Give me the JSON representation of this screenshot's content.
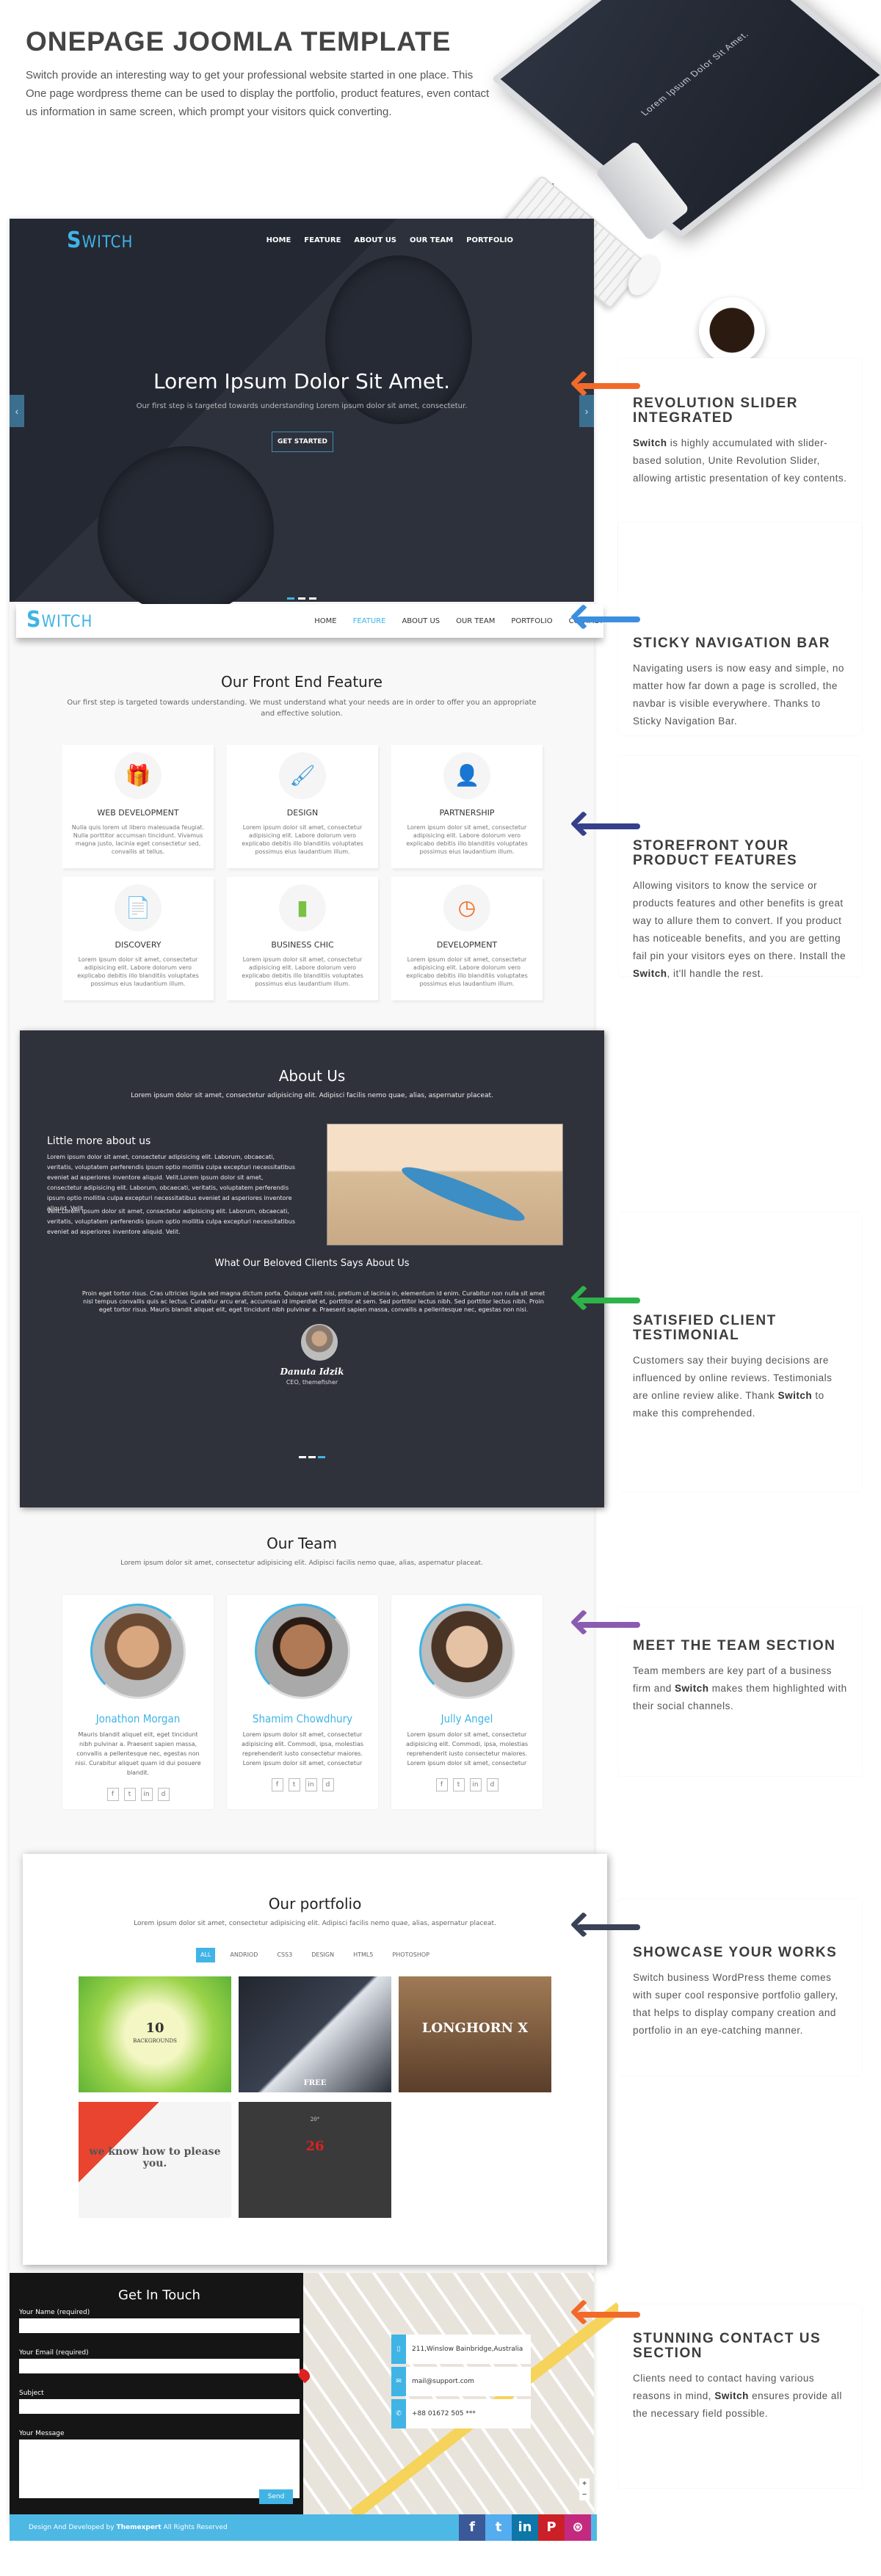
{
  "header": {
    "title": "ONEPAGE JOOMLA TEMPLATE",
    "intro": "Switch provide an interesting way to get your professional website started in one place. This One page wordpress theme can be used to display the portfolio, product features, even contact us information in same screen, which prompt your visitors quick converting."
  },
  "mockup": {
    "screen_text": "Lorem Ipsum Dolor Sit Amet."
  },
  "brand": {
    "logo_s": "S",
    "logo_rest": "WITCH",
    "accent": "#40b4e5"
  },
  "hero": {
    "nav": [
      "HOME",
      "FEATURE",
      "ABOUT US",
      "OUR TEAM",
      "PORTFOLIO"
    ],
    "title": "Lorem Ipsum Dolor Sit Amet.",
    "subtitle": "Our first step is targeted towards understanding Lorem ipsum dolor sit amet, consectetur.",
    "button": "GET STARTED",
    "prev_icon": "chevron-left",
    "next_icon": "chevron-right",
    "active_slide": 1,
    "slides": 3
  },
  "sticky_nav": {
    "items": [
      "HOME",
      "FEATURE",
      "ABOUT US",
      "OUR TEAM",
      "PORTFOLIO",
      "CONTACT"
    ],
    "active": "FEATURE"
  },
  "features": {
    "title": "Our Front End Feature",
    "subtitle": "Our first step is targeted towards understanding. We must understand what your needs are in order to offer you an appropriate and effective solution.",
    "items": [
      {
        "title": "WEB DEVELOPMENT",
        "icon": "gift",
        "text": "Nulla quis lorem ut libero malesuada feugiat. Nulla porttitor accumsan tincidunt. Vivamus magna justo, lacinia eget consectetur sed, convallis at tellus."
      },
      {
        "title": "DESIGN",
        "icon": "brush",
        "text": "Lorem ipsum dolor sit amet, consectetur adipisicing elit. Labore dolorum vero explicabo debitis illo blanditiis voluptates possimus eius laudantium illum."
      },
      {
        "title": "PARTNERSHIP",
        "icon": "user",
        "text": "Lorem ipsum dolor sit amet, consectetur adipisicing elit. Labore dolorum vero explicabo debitis illo blanditiis voluptates possimus eius laudantium illum."
      },
      {
        "title": "DISCOVERY",
        "icon": "document",
        "text": "Lorem ipsum dolor sit amet, consectetur adipisicing elit. Labore dolorum vero explicabo debitis illo blanditiis voluptates possimus eius laudantium illum."
      },
      {
        "title": "BUSINESS CHIC",
        "icon": "chart",
        "text": "Lorem ipsum dolor sit amet, consectetur adipisicing elit. Labore dolorum vero explicabo debitis illo blanditiis voluptates possimus eius laudantium illum."
      },
      {
        "title": "DEVELOPMENT",
        "icon": "clock",
        "text": "Lorem ipsum dolor sit amet, consectetur adipisicing elit. Labore dolorum vero explicabo debitis illo blanditiis voluptates possimus eius laudantium illum."
      }
    ]
  },
  "about": {
    "title": "About Us",
    "subtitle": "Lorem ipsum dolor sit amet, consectetur adipisicing elit. Adipisci facilis nemo quae, alias, aspernatur placeat.",
    "heading": "Little more about us",
    "para1": "Lorem ipsum dolor sit amet, consectetur adipisicing elit. Laborum, obcaecati, veritatis, voluptatem perferendis ipsum optio mollitia culpa excepturi necessitatibus eveniet ad asperiores inventore aliquid. Velit.Lorem ipsum dolor sit amet, consectetur adipisicing elit. Laborum, obcaecati, veritatis, voluptatem perferendis ipsum optio mollitia culpa excepturi necessitatibus eveniet ad asperiores inventore aliquid. Velit.",
    "para2": "Velit.Lorem ipsum dolor sit amet, consectetur adipisicing elit. Laborum, obcaecati, veritatis, voluptatem perferendis ipsum optio mollitia culpa excepturi necessitatibus eveniet ad asperiores inventore aliquid. Velit."
  },
  "testimonial": {
    "title": "What Our Beloved Clients Says About Us",
    "quote": "Proin eget tortor risus. Cras ultricies ligula sed magna dictum porta. Quisque velit nisi, pretium ut lacinia in, elementum id enim. Curabitur non nulla sit amet nisl tempus convallis quis ac lectus. Curabitur arcu erat, accumsan id imperdiet et, porttitor at sem. Sed porttitor lectus nibh. Sed porttitor lectus nibh. Proin eget tortor risus. Mauris blandit aliquet elit, eget tincidunt nibh pulvinar a. Praesent sapien massa, convallis a pellentesque nec, egestas non nisi.",
    "name": "Danuta Idzik",
    "role": "CEO, themefisher",
    "active_slide": 3,
    "slides": 3
  },
  "team": {
    "title": "Our Team",
    "subtitle": "Lorem ipsum dolor sit amet, consectetur adipisicing elit. Adipisci facilis nemo quae, alias, aspernatur placeat.",
    "social": [
      "f",
      "t",
      "in",
      "d"
    ],
    "members": [
      {
        "name": "Jonathon Morgan",
        "text": "Mauris blandit aliquet elit, eget tincidunt nibh pulvinar a. Praesent sapien massa, convallis a pellentesque nec, egestas non nisi. Curabitur aliquet quam id dui posuere blandit."
      },
      {
        "name": "Shamim Chowdhury",
        "text": "Lorem ipsum dolor sit amet, consectetur adipisicing elit. Commodi, ipsa, molestias reprehenderit iusto consectetur maiores. Lorem ipsum dolor sit amet, consectetur"
      },
      {
        "name": "Jully Angel",
        "text": "Lorem ipsum dolor sit amet, consectetur adipisicing elit. Commodi, ipsa, molestias reprehenderit iusto consectetur maiores. Lorem ipsum dolor sit amet, consectetur"
      }
    ]
  },
  "portfolio": {
    "title": "Our portfolio",
    "subtitle": "Lorem ipsum dolor sit amet, consectetur adipisicing elit. Adipisci facilis nemo quae, alias, aspernatur placeat.",
    "filters": [
      "ALL",
      "ANDRIOD",
      "CSS3",
      "DESIGN",
      "HTML5",
      "PHOTOSHOP"
    ],
    "active_filter": "ALL",
    "items": [
      {
        "label": "10",
        "sub": "BACKGROUNDS"
      },
      {
        "label": "FREE",
        "sub": ""
      },
      {
        "label": "LONGHORN X",
        "sub": ""
      },
      {
        "label": "we know how to please you.",
        "sub": ""
      },
      {
        "label": "26",
        "sub": "20°"
      }
    ]
  },
  "contact": {
    "title": "Get In Touch",
    "fields": [
      "Your Name (required)",
      "Your Email (required)",
      "Subject",
      "Your Message"
    ],
    "send": "Send",
    "info": [
      {
        "icon": "mobile",
        "text": "211,Winslow Bainbridge,Australia"
      },
      {
        "icon": "envelope",
        "text": "mail@support.com"
      },
      {
        "icon": "phone",
        "text": "+88 01672 505 ***"
      }
    ]
  },
  "footer": {
    "pre": "Design And Developed by ",
    "bold": "Themexpert",
    "post": " All Rights Reserved",
    "social": [
      {
        "icon": "facebook",
        "glyph": "f",
        "color": "#3b5998"
      },
      {
        "icon": "twitter",
        "glyph": "t",
        "color": "#55acee"
      },
      {
        "icon": "linkedin",
        "glyph": "in",
        "color": "#0e76a8"
      },
      {
        "icon": "pinterest",
        "glyph": "P",
        "color": "#cb2027"
      },
      {
        "icon": "dribbble",
        "glyph": "⊛",
        "color": "#c32a7f"
      }
    ]
  },
  "callouts": [
    {
      "heading": "REVOLUTION SLIDER INTEGRATED",
      "pre": "",
      "bold": "Switch",
      "post": " is highly accumulated with slider-based solution, Unite Revolution Slider, allowing artistic presentation of key contents.",
      "arrow_color": "#f26a2a"
    },
    {
      "heading": "STICKY NAVIGATION BAR",
      "pre": "Navigating users is now easy and simple, no matter how far down a page is scrolled, the navbar is visible everywhere. Thanks to Sticky Navigation Bar.",
      "bold": "",
      "post": "",
      "arrow_color": "#3b8fe0"
    },
    {
      "heading": "STOREFRONT YOUR PRODUCT FEATURES",
      "pre": "Allowing visitors to know the service or products features and other benefits is great way to allure them to convert. If you product has noticeable benefits, and you are getting fail pin your visitors eyes on there. Install the ",
      "bold": "Switch",
      "post": ", it'll handle the rest.",
      "arrow_color": "#34408a"
    },
    {
      "heading": "SATISFIED CLIENT TESTIMONIAL",
      "pre": "Customers say their buying decisions are influenced by online reviews. Testimonials are online review alike. Thank ",
      "bold": "Switch",
      "post": " to make this comprehended.",
      "arrow_color": "#2db34a"
    },
    {
      "heading": "MEET THE TEAM SECTION",
      "pre": "Team members are key part of a business firm and ",
      "bold": "Switch",
      "post": " makes them highlighted with their social channels.",
      "arrow_color": "#8a5bb0"
    },
    {
      "heading": "SHOWCASE YOUR WORKS",
      "pre": "Switch business WordPress theme comes with super cool responsive portfolio gallery, that helps to display company creation and portfolio in an eye-catching manner.",
      "bold": "",
      "post": "",
      "arrow_color": "#3a4256"
    },
    {
      "heading": "STUNNING CONTACT US SECTION",
      "pre": "Clients need to contact having various reasons in mind, ",
      "bold": "Switch",
      "post": " ensures provide all the necessary field possible.",
      "arrow_color": "#f26a2a"
    }
  ]
}
